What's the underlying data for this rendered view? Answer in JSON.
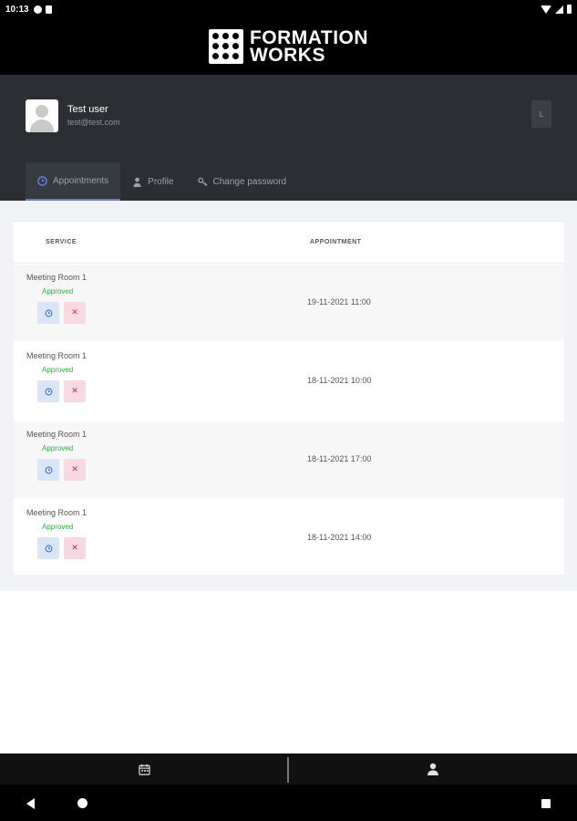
{
  "status_bar": {
    "time": "10:13"
  },
  "brand": {
    "line1": "FORMATION",
    "line2": "WORKS"
  },
  "user": {
    "name": "Test user",
    "email": "test@test.com"
  },
  "logout": {
    "label": "L"
  },
  "tabs": [
    {
      "label": "Appointments",
      "icon": "clock-icon",
      "active": true
    },
    {
      "label": "Profile",
      "icon": "user-icon",
      "active": false
    },
    {
      "label": "Change password",
      "icon": "key-icon",
      "active": false
    }
  ],
  "table": {
    "headers": {
      "service": "SERVICE",
      "appointment": "APPOINTMENT"
    },
    "rows": [
      {
        "service": "Meeting Room 1",
        "status": "Approved",
        "datetime": "19-11-2021 11:00"
      },
      {
        "service": "Meeting Room 1",
        "status": "Approved",
        "datetime": "18-11-2021 10:00"
      },
      {
        "service": "Meeting Room 1",
        "status": "Approved",
        "datetime": "18-11-2021 17:00"
      },
      {
        "service": "Meeting Room 1",
        "status": "Approved",
        "datetime": "18-11-2021 14:00"
      }
    ]
  },
  "colors": {
    "header_bg": "#000000",
    "panel_bg": "#2b2f33",
    "accent": "#6c7bd9",
    "approved": "#2fb344",
    "cancel": "#e0245e"
  },
  "bottom_nav": [
    {
      "icon": "calendar-icon"
    },
    {
      "icon": "person-icon"
    }
  ]
}
